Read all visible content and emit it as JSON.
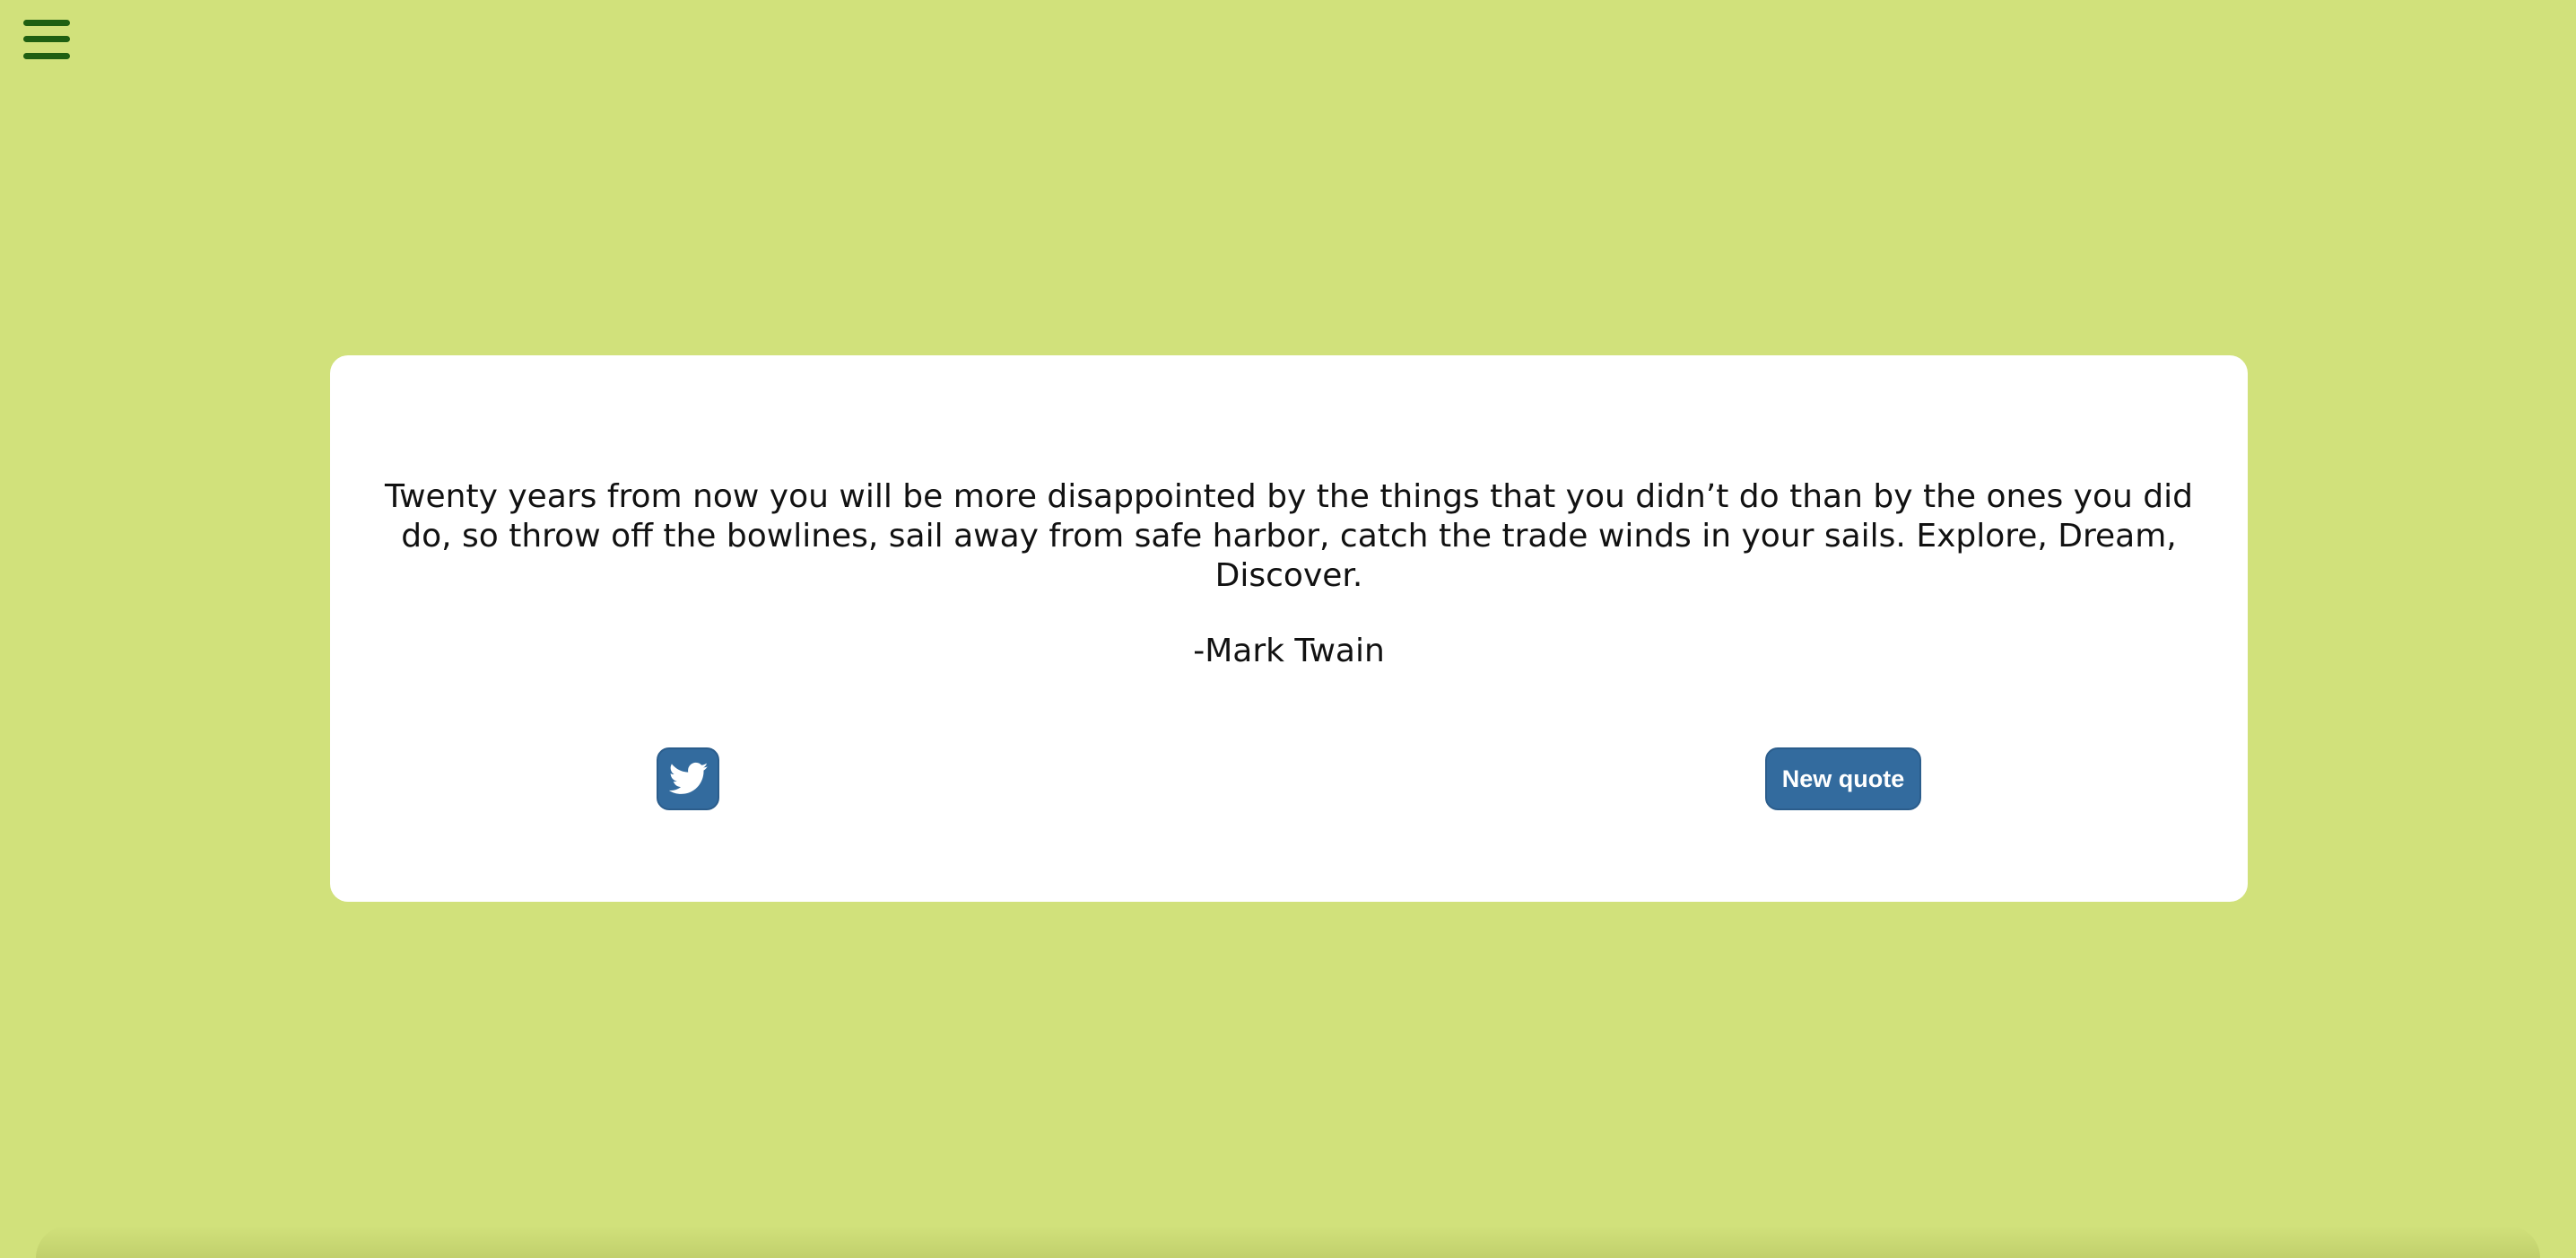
{
  "page": {
    "background_color": "#d1e17b",
    "accent_color": "#336b9e",
    "menu_icon_color": "#1f5f12"
  },
  "menu": {
    "icon": "hamburger-menu-icon"
  },
  "quote": {
    "text": "Twenty years from now you will be more disappointed by the things that you didn’t do than by the ones you did do, so throw off the bowlines, sail away from safe harbor, catch the trade winds in your sails. Explore, Dream, Discover.",
    "author": "-Mark Twain"
  },
  "actions": {
    "tweet_icon": "twitter-icon",
    "new_quote_label": "New quote"
  }
}
